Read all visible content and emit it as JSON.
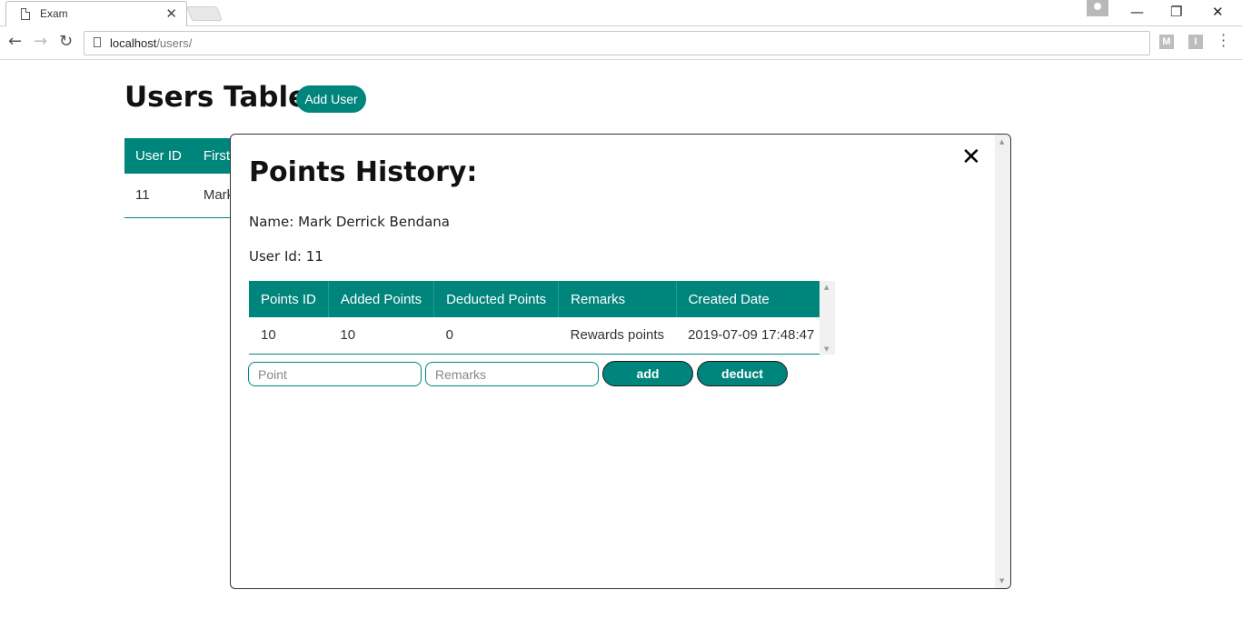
{
  "browser": {
    "tab_title": "Exam",
    "tab_close": "✕",
    "url_host": "localhost",
    "url_path": "/users/",
    "ext1": "M",
    "ext2": "I",
    "win_min": "—",
    "win_restore": "❐",
    "win_close": "✕"
  },
  "page": {
    "title": "Users Table:",
    "add_user_label": "Add User",
    "users_table": {
      "headers": [
        "User ID",
        "First"
      ],
      "rows": [
        [
          "11",
          "Mark"
        ]
      ]
    }
  },
  "modal": {
    "title": "Points History:",
    "close_label": "✕",
    "name_line": "Name: Mark Derrick Bendana",
    "userid_line": "User Id: 11",
    "points_table": {
      "headers": [
        "Points ID",
        "Added Points",
        "Deducted Points",
        "Remarks",
        "Created Date"
      ],
      "rows": [
        [
          "10",
          "10",
          "0",
          "Rewards points",
          "2019-07-09 17:48:47"
        ]
      ]
    },
    "point_placeholder": "Point",
    "remarks_placeholder": "Remarks",
    "add_label": "add",
    "deduct_label": "deduct"
  },
  "colors": {
    "accent": "#00857c"
  }
}
